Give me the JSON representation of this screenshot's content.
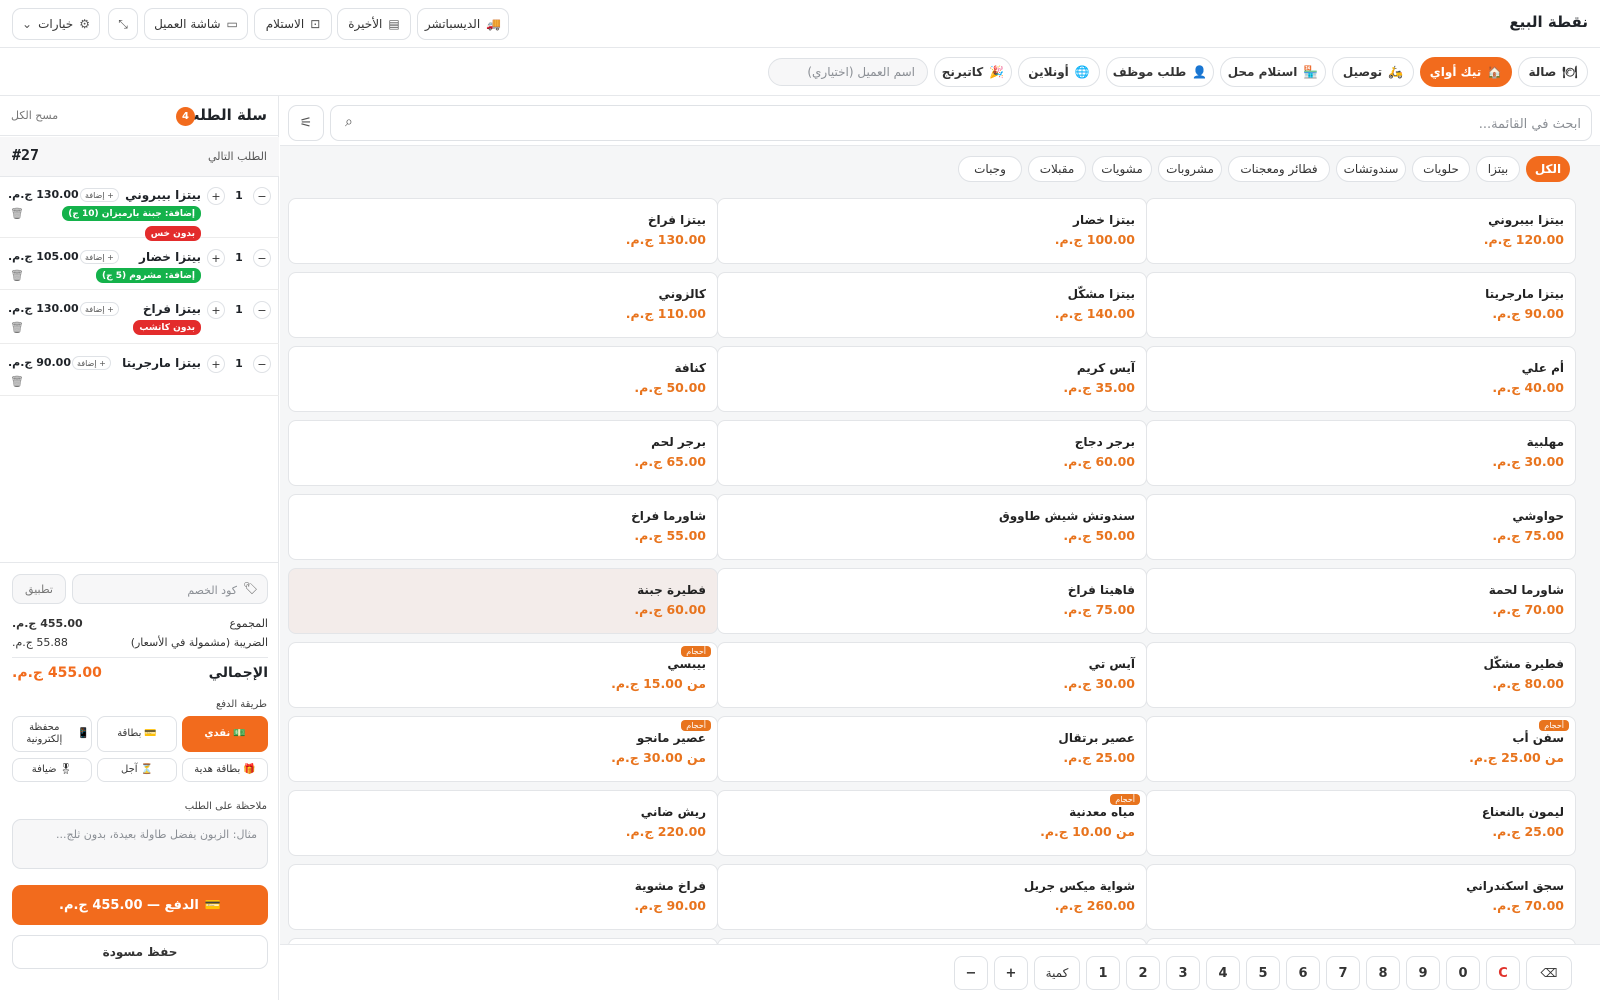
{
  "header": {
    "title": "نقطة البيع",
    "buttons": [
      {
        "label": "الديسباتشر",
        "icon": "truck-icon"
      },
      {
        "label": "الأخيرة",
        "icon": "receipt-icon"
      },
      {
        "label": "الاستلام",
        "icon": "bag-icon"
      },
      {
        "label": "شاشة العميل",
        "icon": "monitor-icon"
      },
      {
        "label": "",
        "icon": "fullscreen-exit-icon"
      },
      {
        "label": "خيارات",
        "icon": "gear-icon"
      }
    ]
  },
  "order_types": [
    {
      "label": "صالة",
      "icon": "dine-in-icon"
    },
    {
      "label": "تيك أواي",
      "icon": "takeaway-icon",
      "active": true
    },
    {
      "label": "توصيل",
      "icon": "scooter-icon"
    },
    {
      "label": "استلام محل",
      "icon": "store-icon"
    },
    {
      "label": "طلب موظف",
      "icon": "person-icon"
    },
    {
      "label": "أونلاين",
      "icon": "globe-icon"
    },
    {
      "label": "كاتيرنج",
      "icon": "party-icon"
    }
  ],
  "customer_placeholder": "اسم العميل (اختياري)",
  "search_placeholder": "ابحث في القائمة...",
  "categories": [
    "الكل",
    "بيتزا",
    "حلويات",
    "سندوتشات",
    "فطائر ومعجنات",
    "مشروبات",
    "مشويات",
    "مقبلات",
    "وجبات"
  ],
  "active_category": "الكل",
  "size_badge": "أحجام",
  "products": [
    {
      "name": "بيتزا بيبروني",
      "price": "120.00 ج.م."
    },
    {
      "name": "بيتزا خضار",
      "price": "100.00 ج.م."
    },
    {
      "name": "بيتزا فراخ",
      "price": "130.00 ج.م."
    },
    {
      "name": "بيتزا مارجريتا",
      "price": "90.00 ج.م."
    },
    {
      "name": "بيتزا مشكّل",
      "price": "140.00 ج.م."
    },
    {
      "name": "كالزوني",
      "price": "110.00 ج.م."
    },
    {
      "name": "أم علي",
      "price": "40.00 ج.م."
    },
    {
      "name": "آيس كريم",
      "price": "35.00 ج.م."
    },
    {
      "name": "كنافة",
      "price": "50.00 ج.م."
    },
    {
      "name": "مهلبية",
      "price": "30.00 ج.م."
    },
    {
      "name": "برجر دجاج",
      "price": "60.00 ج.م."
    },
    {
      "name": "برجر لحم",
      "price": "65.00 ج.م."
    },
    {
      "name": "حواوشي",
      "price": "75.00 ج.م."
    },
    {
      "name": "سندوتش شيش طاووق",
      "price": "50.00 ج.م."
    },
    {
      "name": "شاورما فراخ",
      "price": "55.00 ج.م."
    },
    {
      "name": "شاورما لحمة",
      "price": "70.00 ج.م."
    },
    {
      "name": "فاهيتا فراخ",
      "price": "75.00 ج.م."
    },
    {
      "name": "فطيرة جبنة",
      "price": "60.00 ج.م.",
      "highlight": true
    },
    {
      "name": "فطيرة مشكّل",
      "price": "80.00 ج.م."
    },
    {
      "name": "آيس تي",
      "price": "30.00 ج.م."
    },
    {
      "name": "بيبسي",
      "price": "من 15.00 ج.م.",
      "sizes": true
    },
    {
      "name": "سفن أب",
      "price": "من 25.00 ج.م.",
      "sizes": true
    },
    {
      "name": "عصير برتقال",
      "price": "25.00 ج.م."
    },
    {
      "name": "عصير مانجو",
      "price": "من 30.00 ج.م.",
      "sizes": true
    },
    {
      "name": "ليمون بالنعناع",
      "price": "25.00 ج.م."
    },
    {
      "name": "مياه معدنية",
      "price": "من 10.00 ج.م.",
      "sizes": true
    },
    {
      "name": "ريش ضاني",
      "price": "220.00 ج.م."
    },
    {
      "name": "سجق اسكندراني",
      "price": "70.00 ج.م."
    },
    {
      "name": "شواية ميكس جريل",
      "price": "260.00 ج.م."
    },
    {
      "name": "فراخ مشوية",
      "price": "90.00 ج.م."
    }
  ],
  "keypad": {
    "digits": [
      "1",
      "2",
      "3",
      "4",
      "5",
      "6",
      "7",
      "8",
      "9",
      "0"
    ],
    "clear": "C",
    "backspace": "⌫",
    "qty_label": "كمية",
    "plus": "+",
    "minus": "−"
  },
  "cart": {
    "title": "سلة الطلب",
    "count": "4",
    "clear_all": "مسح الكل",
    "next_order_label": "الطلب التالي",
    "order_number": "#27",
    "add_label": "+ إضافة",
    "items": [
      {
        "name": "بيتزا بيبروني",
        "qty": "1",
        "price": "130.00 ج.م.",
        "tags": [
          {
            "text": "إضافة: جبنة بارميزان (10 ج)",
            "type": "green"
          },
          {
            "text": "بدون خس",
            "type": "red"
          }
        ]
      },
      {
        "name": "بيتزا خضار",
        "qty": "1",
        "price": "105.00 ج.م.",
        "tags": [
          {
            "text": "إضافة: مشروم (5 ج)",
            "type": "green"
          }
        ]
      },
      {
        "name": "بيتزا فراخ",
        "qty": "1",
        "price": "130.00 ج.م.",
        "tags": [
          {
            "text": "بدون كاتشب",
            "type": "red"
          }
        ]
      },
      {
        "name": "بيتزا مارجريتا",
        "qty": "1",
        "price": "90.00 ج.م.",
        "tags": []
      }
    ],
    "coupon_placeholder": "كود الخصم",
    "apply_label": "تطبيق",
    "subtotal_label": "المجموع",
    "subtotal": "455.00 ج.م.",
    "tax_label": "الضريبة (مشمولة في الأسعار)",
    "tax": "55.88 ج.م.",
    "total_label": "الإجمالي",
    "total": "455.00 ج.م.",
    "payment_label": "طريقة الدفع",
    "payment_methods": [
      {
        "label": "نقدي",
        "icon": "cash-icon",
        "glyph": "💵",
        "active": true
      },
      {
        "label": "بطاقة",
        "icon": "card-icon",
        "glyph": "💳"
      },
      {
        "label": "محفظة إلكترونية",
        "icon": "wallet-icon",
        "glyph": "📱"
      },
      {
        "label": "بطاقة هدية",
        "icon": "gift-icon",
        "glyph": "🎁"
      },
      {
        "label": "آجل",
        "icon": "hourglass-icon",
        "glyph": "⏳"
      },
      {
        "label": "ضيافة",
        "icon": "medal-icon",
        "glyph": "🎖"
      }
    ],
    "note_label": "ملاحظة على الطلب",
    "note_placeholder": "مثال: الزبون يفضل طاولة بعيدة، بدون ثلج...",
    "pay_label": "الدفع — 455.00 ج.م.",
    "draft_label": "حفظ مسودة"
  },
  "colors": {
    "accent": "#f26b1d",
    "price": "#e8741e",
    "green_tag": "#14b24b",
    "red_tag": "#e32c2c"
  }
}
